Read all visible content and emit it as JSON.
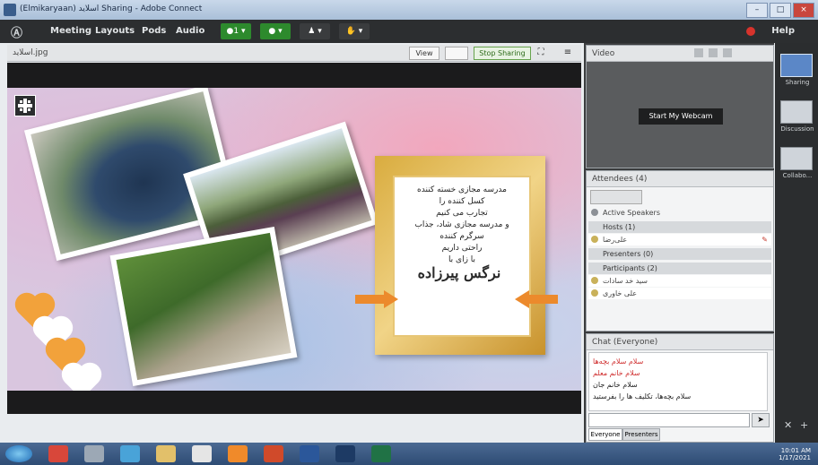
{
  "window": {
    "title": "(Elmikaryaan) اسلاید Sharing - Adobe Connect",
    "controls": [
      "–",
      "□",
      "×"
    ]
  },
  "menubar": {
    "items": [
      "Meeting",
      "Layouts",
      "Pods",
      "Audio"
    ],
    "status_buttons": [
      {
        "name": "mic-status",
        "label": "●1 ▾",
        "color": "#2d8a2d"
      },
      {
        "name": "camera-status",
        "label": "● ▾",
        "color": "#2d8a2d"
      },
      {
        "name": "user-status",
        "label": "♟ ▾",
        "color": "#3a3c3e"
      },
      {
        "name": "raise-hand-status",
        "label": "✋ ▾",
        "color": "#3a3c3e"
      }
    ],
    "help": "Help"
  },
  "share_pod": {
    "title": "اسلاید.jpg",
    "buttons": {
      "view": "View",
      "stop": "Stop Sharing",
      "fullscreen": "⛶",
      "menu": "≡"
    }
  },
  "slide": {
    "poem_lines": [
      "مدرسه مجازی خسته کننده",
      "کسل کننده را",
      "تجارب می کنیم",
      "و مدرسه مجازی شاد، جذاب",
      "سرگرم کننده",
      "راحتی داریم",
      "با زای با"
    ],
    "name": "نرگس پیرزاده",
    "colors": {
      "frame": "#e2b451",
      "arrows": "#ec8a2c",
      "hearts_orange": "#f2a23b",
      "hearts_white": "#ffffff"
    }
  },
  "video_pod": {
    "title": "Video",
    "start_button": "Start My Webcam"
  },
  "attendees_pod": {
    "title": "Attendees (4)",
    "active_speakers": "Active Speakers",
    "hosts_header": "Hosts (1)",
    "hosts": [
      "علی‌رضا"
    ],
    "presenters_header": "Presenters (0)",
    "participants_header": "Participants (2)",
    "participants": [
      "سید خد سادات",
      "علی خاوری"
    ]
  },
  "chat_pod": {
    "title": "Chat (Everyone)",
    "messages": [
      {
        "text": "سلام سلام بچه‌ها",
        "color": "#cf2d2d"
      },
      {
        "text": "سلام خانم معلم",
        "color": "#cf2d2d"
      },
      {
        "text": "سلام خانم جان",
        "color": "#222222"
      },
      {
        "text": "سلام بچه‌ها، تکلیف ها را بفرستید",
        "color": "#222222"
      }
    ],
    "tabs": [
      "Everyone",
      "Presenters"
    ]
  },
  "layouts": [
    {
      "label": "Sharing"
    },
    {
      "label": "Discussion"
    },
    {
      "label": "Collabo..."
    }
  ],
  "taskbar": {
    "clock": "10:01 AM",
    "date": "1/17/2021"
  }
}
